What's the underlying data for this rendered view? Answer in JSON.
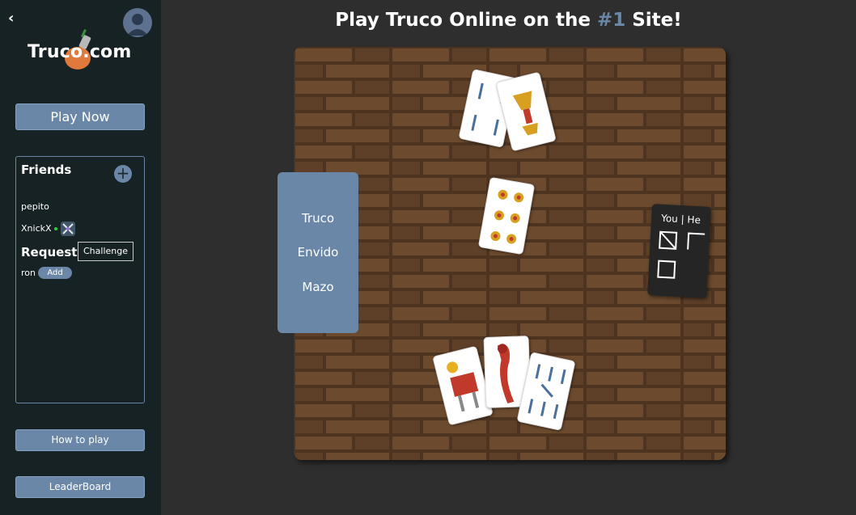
{
  "sidebar": {
    "back_icon": "‹",
    "logo_text": "Truco.com",
    "play_now": "Play Now",
    "friends_title": "Friends",
    "add_icon": "+",
    "friends": [
      {
        "name": "pepito",
        "online": false
      },
      {
        "name": "XnickX",
        "online": true
      }
    ],
    "requests_title": "Requests",
    "tooltip": "Challenge",
    "requests": [
      {
        "name": "ron",
        "button": "Add"
      }
    ],
    "how_to_play": "How to play",
    "leaderboard": "LeaderBoard"
  },
  "headline": {
    "pre": "Play Truco Online on the ",
    "accent": "#1",
    "post": " Site!"
  },
  "actions": {
    "truco": "Truco",
    "envido": "Envido",
    "mazo": "Mazo"
  },
  "score": {
    "label": "You | He"
  },
  "colors": {
    "accent": "#6a87a8",
    "sidebar": "#172224",
    "background": "#2e2e2e",
    "board_wood": "#4d3421"
  }
}
